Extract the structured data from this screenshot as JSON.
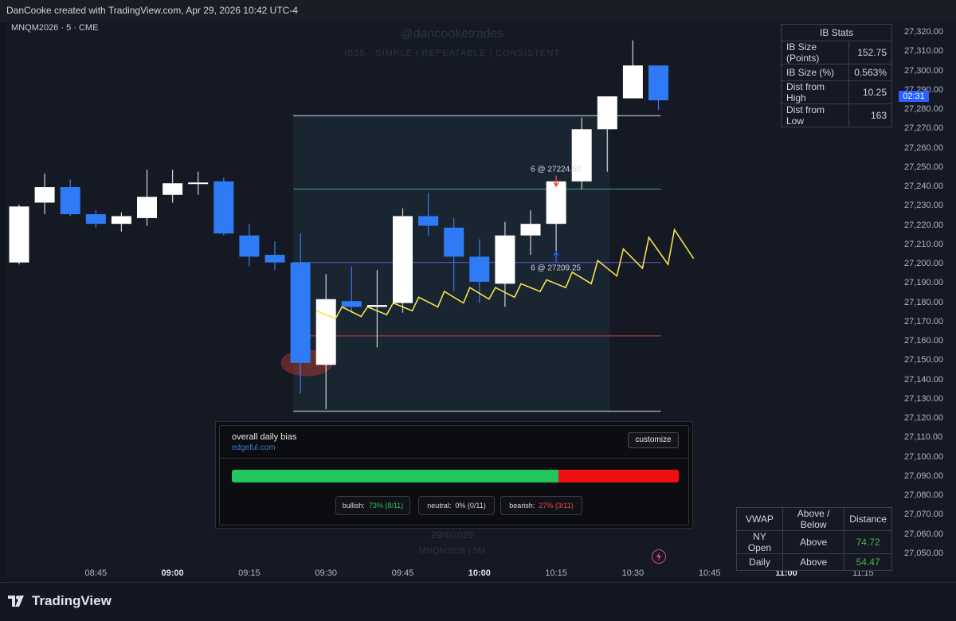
{
  "header": {
    "caption": "DanCooke created with TradingView.com, Apr 29, 2026 10:42 UTC-4"
  },
  "symbol": {
    "label": "MNQM2026 · 5 · CME"
  },
  "watermark": {
    "handle": "@dancooketrades",
    "tagline": "IB25  -  SIMPLE  |  REPEATABLE  |  CONSISTENT",
    "date": "29/4/2026",
    "symbol": "MNQM2026 | 5M"
  },
  "y_axis": {
    "labels": [
      "27,320.00",
      "27,310.00",
      "27,300.00",
      "27,290.00",
      "27,280.00",
      "27,270.00",
      "27,260.00",
      "27,250.00",
      "27,240.00",
      "27,230.00",
      "27,220.00",
      "27,210.00",
      "27,200.00",
      "27,190.00",
      "27,180.00",
      "27,170.00",
      "27,160.00",
      "27,150.00",
      "27,140.00",
      "27,130.00",
      "27,120.00",
      "27,110.00",
      "27,100.00",
      "27,090.00",
      "27,080.00",
      "27,070.00",
      "27,060.00",
      "27,050.00"
    ],
    "price_tag": "02:31"
  },
  "x_axis": {
    "labels": [
      {
        "text": "08:45",
        "bold": false
      },
      {
        "text": "09:00",
        "bold": true
      },
      {
        "text": "09:15",
        "bold": false
      },
      {
        "text": "09:30",
        "bold": false
      },
      {
        "text": "09:45",
        "bold": false
      },
      {
        "text": "10:00",
        "bold": true
      },
      {
        "text": "10:15",
        "bold": false
      },
      {
        "text": "10:30",
        "bold": false
      },
      {
        "text": "10:45",
        "bold": false
      },
      {
        "text": "11:00",
        "bold": true
      },
      {
        "text": "11:15",
        "bold": false
      }
    ]
  },
  "chart_data": {
    "type": "candlestick",
    "symbol": "MNQM2026",
    "interval": "5",
    "ylim": [
      27045,
      27325
    ],
    "candles": [
      {
        "time": "08:30",
        "open": 27201,
        "high": 27231,
        "low": 27200,
        "close": 27230,
        "color": "white"
      },
      {
        "time": "08:35",
        "open": 27232,
        "high": 27247,
        "low": 27226,
        "close": 27240,
        "color": "white"
      },
      {
        "time": "08:40",
        "open": 27240,
        "high": 27244,
        "low": 27225,
        "close": 27226,
        "color": "blue"
      },
      {
        "time": "08:45",
        "open": 27226,
        "high": 27228,
        "low": 27219,
        "close": 27221,
        "color": "blue"
      },
      {
        "time": "08:50",
        "open": 27221,
        "high": 27227,
        "low": 27217,
        "close": 27225,
        "color": "white"
      },
      {
        "time": "08:55",
        "open": 27224,
        "high": 27249,
        "low": 27220,
        "close": 27235,
        "color": "white"
      },
      {
        "time": "09:00",
        "open": 27236,
        "high": 27249,
        "low": 27232,
        "close": 27242,
        "color": "white"
      },
      {
        "time": "09:05",
        "open": 27242,
        "high": 27248,
        "low": 27236,
        "close": 27242,
        "color": "white"
      },
      {
        "time": "09:10",
        "open": 27243,
        "high": 27245,
        "low": 27215,
        "close": 27216,
        "color": "blue"
      },
      {
        "time": "09:15",
        "open": 27215,
        "high": 27221,
        "low": 27199,
        "close": 27204,
        "color": "blue"
      },
      {
        "time": "09:20",
        "open": 27205,
        "high": 27212,
        "low": 27197,
        "close": 27201,
        "color": "blue"
      },
      {
        "time": "09:25",
        "open": 27201,
        "high": 27216,
        "low": 27133,
        "close": 27149,
        "color": "blue"
      },
      {
        "time": "09:30",
        "open": 27148,
        "high": 27195,
        "low": 27125,
        "close": 27182,
        "color": "white"
      },
      {
        "time": "09:35",
        "open": 27181,
        "high": 27199,
        "low": 27175,
        "close": 27178,
        "color": "blue"
      },
      {
        "time": "09:40",
        "open": 27178,
        "high": 27197,
        "low": 27157,
        "close": 27179,
        "color": "white"
      },
      {
        "time": "09:45",
        "open": 27180,
        "high": 27229,
        "low": 27175,
        "close": 27225,
        "color": "white"
      },
      {
        "time": "09:50",
        "open": 27225,
        "high": 27237,
        "low": 27215,
        "close": 27220,
        "color": "blue"
      },
      {
        "time": "09:55",
        "open": 27219,
        "high": 27224,
        "low": 27186,
        "close": 27204,
        "color": "blue"
      },
      {
        "time": "10:00",
        "open": 27204,
        "high": 27213,
        "low": 27180,
        "close": 27191,
        "color": "blue"
      },
      {
        "time": "10:05",
        "open": 27190,
        "high": 27222,
        "low": 27178,
        "close": 27215,
        "color": "white"
      },
      {
        "time": "10:10",
        "open": 27215,
        "high": 27228,
        "low": 27205,
        "close": 27221,
        "color": "white"
      },
      {
        "time": "10:15",
        "open": 27221,
        "high": 27244,
        "low": 27207,
        "close": 27243,
        "color": "white"
      },
      {
        "time": "10:20",
        "open": 27243,
        "high": 27276,
        "low": 27239,
        "close": 27270,
        "color": "white"
      },
      {
        "time": "10:25",
        "open": 27270,
        "high": 27287,
        "low": 27248,
        "close": 27287,
        "color": "white"
      },
      {
        "time": "10:30",
        "open": 27286,
        "high": 27316,
        "low": 27286,
        "close": 27303,
        "color": "white"
      },
      {
        "time": "10:35",
        "open": 27303,
        "high": 27303,
        "low": 27280,
        "close": 27285,
        "color": "blue"
      }
    ],
    "vwap_line": [
      [
        27176,
        27172
      ],
      [
        27178,
        27173
      ],
      [
        27178,
        27174
      ],
      [
        27180,
        27176
      ],
      [
        27183,
        27178
      ],
      [
        27186,
        27180
      ],
      [
        27188,
        27182
      ],
      [
        27188,
        27183
      ],
      [
        27190,
        27186
      ],
      [
        27192,
        27188
      ],
      [
        27196,
        27190
      ],
      [
        27202,
        27194
      ],
      [
        27208,
        27198
      ],
      [
        27214,
        27200
      ],
      [
        27218,
        27203
      ]
    ],
    "levels": {
      "ib_high": 27277,
      "upper_band": 27239,
      "mid_band": 27201,
      "lower_band": 27163,
      "ib_low": 27124
    },
    "annotations": [
      {
        "text": "6 @ 27224.50",
        "arrow": "down",
        "color": "#ef4444"
      },
      {
        "text": "6 @ 27209.25",
        "arrow": "up",
        "color": "#2962ff"
      }
    ],
    "highlight": {
      "note": "red ellipse around low of 09:25 candle"
    }
  },
  "ib_stats": {
    "title": "IB Stats",
    "rows": [
      {
        "label": "IB Size (Points)",
        "value": "152.75"
      },
      {
        "label": "IB Size (%)",
        "value": "0.563%"
      },
      {
        "label": "Dist from High",
        "value": "10.25"
      },
      {
        "label": "Dist from Low",
        "value": "163"
      }
    ]
  },
  "vwap_table": {
    "headers": [
      "VWAP",
      "Above / Below",
      "Distance"
    ],
    "rows": [
      {
        "label": "NY Open",
        "position": "Above",
        "distance": "74.72"
      },
      {
        "label": "Daily",
        "position": "Above",
        "distance": "54.47"
      }
    ]
  },
  "bias_panel": {
    "title": "overall daily bias",
    "link": "edgeful.com",
    "customize_label": "customize",
    "bullish_pct": 73,
    "bearish_pct": 27,
    "pills": {
      "bullish_label": "bullish:",
      "bullish_value": "73% (8/11)",
      "neutral_label": "neutral:",
      "neutral_value": "0% (0/11)",
      "bearish_label": "bearish:",
      "bearish_value": "27% (3/11)"
    },
    "colors": {
      "bullish": "#22c55e",
      "bearish": "#ef1111"
    }
  },
  "footer": {
    "brand": "TradingView"
  },
  "colors": {
    "up_candle": "#ffffff",
    "down_candle": "#2f7bf5",
    "vwap": "#f5e04a",
    "accent": "#2962ff"
  }
}
